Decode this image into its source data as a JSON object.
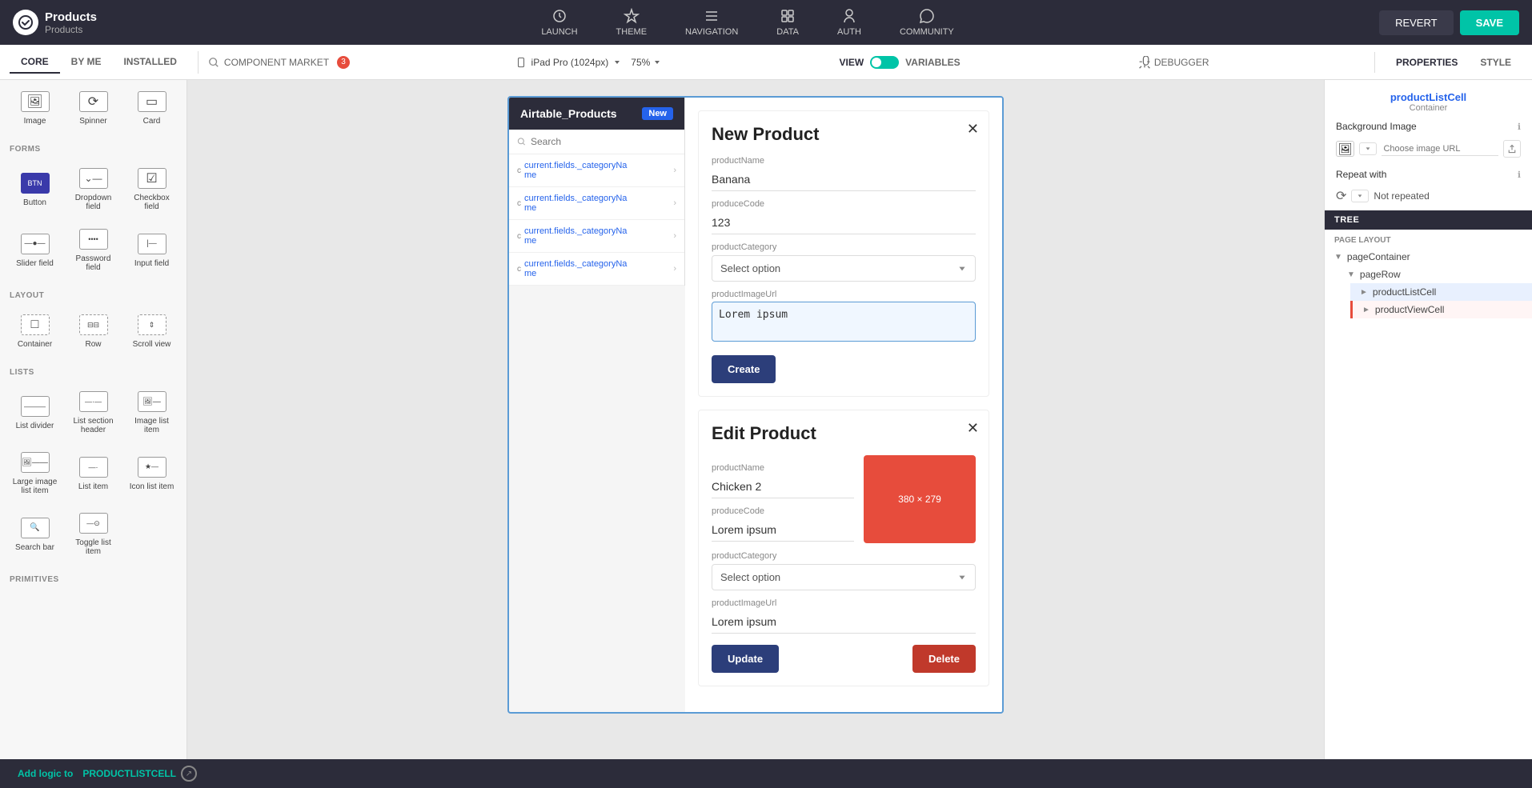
{
  "app": {
    "name": "Products",
    "sub": "Products"
  },
  "topnav": {
    "launch": "LAUNCH",
    "theme": "THEME",
    "navigation": "NAVIGATION",
    "data": "DATA",
    "auth": "AUTH",
    "community": "COMMUNITY",
    "revert": "REVERT",
    "save": "SAVE"
  },
  "toolbar": {
    "tabs": [
      "CORE",
      "BY ME",
      "INSTALLED"
    ],
    "active_tab": "CORE",
    "badge_count": "3",
    "component_market": "COMPONENT MARKET",
    "search_placeholder": "Search",
    "device": "iPad Pro (1024px)",
    "zoom": "75%",
    "view_label": "VIEW",
    "variables_label": "VARIABLES",
    "debugger": "DEBUGGER",
    "properties": "PROPERTIES",
    "style": "STYLE"
  },
  "left_panel": {
    "sections": [
      {
        "name": "FORMS",
        "items": [
          {
            "id": "button",
            "label": "Button",
            "icon": "btn"
          },
          {
            "id": "dropdown",
            "label": "Dropdown field",
            "icon": "dd"
          },
          {
            "id": "checkbox",
            "label": "Checkbox field",
            "icon": "chk"
          },
          {
            "id": "slider",
            "label": "Slider field",
            "icon": "sldr"
          },
          {
            "id": "password",
            "label": "Password field",
            "icon": "pwd"
          },
          {
            "id": "input",
            "label": "Input field",
            "icon": "inp"
          }
        ]
      },
      {
        "name": "LAYOUT",
        "items": [
          {
            "id": "container",
            "label": "Container",
            "icon": "ctnr"
          },
          {
            "id": "row",
            "label": "Row",
            "icon": "row"
          },
          {
            "id": "scroll",
            "label": "Scroll view",
            "icon": "scrl"
          }
        ]
      },
      {
        "name": "LISTS",
        "items": [
          {
            "id": "list-divider",
            "label": "List divider",
            "icon": "div"
          },
          {
            "id": "list-section",
            "label": "List section header",
            "icon": "lsh"
          },
          {
            "id": "image-list",
            "label": "Image list item",
            "icon": "ili"
          },
          {
            "id": "large-image",
            "label": "Large image list item",
            "icon": "lil"
          },
          {
            "id": "list-item",
            "label": "List item",
            "icon": "li"
          },
          {
            "id": "icon-list",
            "label": "Icon list item",
            "icon": "icl"
          },
          {
            "id": "search-bar",
            "label": "Search bar",
            "icon": "sb"
          },
          {
            "id": "toggle-list",
            "label": "Toggle list item",
            "icon": "tli"
          }
        ]
      }
    ],
    "above_items": [
      {
        "id": "image",
        "label": "Image"
      },
      {
        "id": "spinner",
        "label": "Spinner"
      },
      {
        "id": "card",
        "label": "Card"
      }
    ]
  },
  "canvas": {
    "frame_label": "productListCell",
    "list": {
      "title": "Airtable_Products",
      "new_badge": "New",
      "search_placeholder": "Search",
      "items": [
        {
          "prefix": "c",
          "text": "current.fields._categoryNa me"
        },
        {
          "prefix": "c",
          "text": "current.fields._categoryNa me"
        },
        {
          "prefix": "c",
          "text": "current.fields._categoryNa me"
        },
        {
          "prefix": "c",
          "text": "current.fields._categoryNa me"
        }
      ]
    },
    "new_product": {
      "title": "New Product",
      "fields": [
        {
          "label": "productName",
          "value": "Banana",
          "type": "input"
        },
        {
          "label": "produceCode",
          "value": "123",
          "type": "input"
        },
        {
          "label": "productCategory",
          "value": "Select option",
          "type": "select"
        },
        {
          "label": "productImageUrl",
          "value": "Lorem ipsum",
          "type": "textarea"
        }
      ],
      "create_btn": "Create"
    },
    "edit_product": {
      "title": "Edit Product",
      "fields": [
        {
          "label": "productName",
          "value": "Chicken 2",
          "type": "input"
        },
        {
          "label": "produceCode",
          "value": "Lorem ipsum",
          "type": "input"
        },
        {
          "label": "productCategory",
          "value": "Select option",
          "type": "select"
        },
        {
          "label": "productImageUrl",
          "value": "Lorem ipsum",
          "type": "input"
        }
      ],
      "image_size": "380 × 279",
      "update_btn": "Update",
      "delete_btn": "Delete"
    }
  },
  "right_panel": {
    "tabs": [
      "PROPERTIES",
      "STYLE"
    ],
    "active_tab": "PROPERTIES",
    "selected_component": "productListCell",
    "selected_type": "Container",
    "background_image_label": "Background Image",
    "choose_image_url": "Choose image URL",
    "repeat_label": "Repeat with",
    "not_repeated": "Not repeated",
    "tree_header": "TREE",
    "page_layout_label": "PAGE LAYOUT",
    "tree_items": [
      {
        "id": "pageContainer",
        "label": "pageContainer",
        "level": 0,
        "expanded": true
      },
      {
        "id": "pageRow",
        "label": "pageRow",
        "level": 1,
        "expanded": true
      },
      {
        "id": "productListCell",
        "label": "productListCell",
        "level": 2,
        "selected": true,
        "expanded": false
      },
      {
        "id": "productViewCell",
        "label": "productViewCell",
        "level": 2,
        "highlighted": true,
        "expanded": false
      }
    ]
  },
  "bottom_bar": {
    "text": "Add logic to",
    "component": "PRODUCTLISTCELL"
  }
}
